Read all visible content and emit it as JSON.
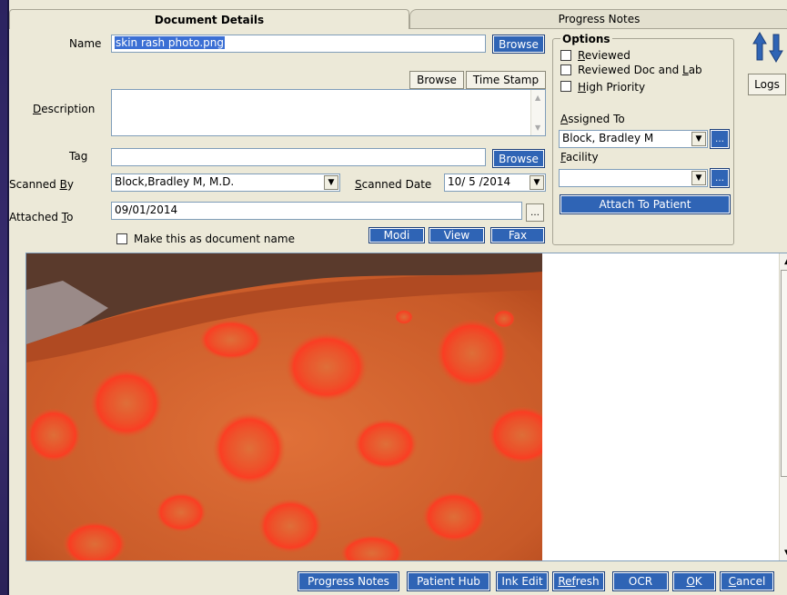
{
  "tabs": {
    "document_details": "Document Details",
    "progress_notes": "Progress Notes"
  },
  "name": {
    "label": "Name",
    "value": "skin rash photo.png",
    "browse": "Browse"
  },
  "browse2": "Browse",
  "time_stamp": "Time Stamp",
  "description": {
    "label_prefix": "",
    "label_u": "D",
    "label_rest": "escription",
    "value": ""
  },
  "tag": {
    "label": "Tag",
    "value": "",
    "browse": "Browse"
  },
  "scanned_by": {
    "label_a": "Scanned ",
    "label_u": "B",
    "label_b": "y",
    "value": "Block,Bradley M, M.D."
  },
  "scanned_date": {
    "label_u": "S",
    "label_b": "canned Date",
    "value": "10/ 5 /2014"
  },
  "attached_to": {
    "label_a": "Attached ",
    "label_u": "T",
    "label_b": "o",
    "value": "09/01/2014"
  },
  "make_doc_name": "Make this as document name",
  "buttons_row": {
    "modi": "Modi",
    "view": "View",
    "fax": "Fax"
  },
  "options": {
    "title": "Options",
    "reviewed_u": "R",
    "reviewed_rest": "eviewed",
    "reviewed_doc_lab_a": "Reviewed Doc and ",
    "reviewed_doc_lab_u": "L",
    "reviewed_doc_lab_b": "ab",
    "high_priority_u": "H",
    "high_priority_rest": "igh Priority",
    "assigned_to_u": "A",
    "assigned_to_rest": "ssigned To",
    "assigned_value": "Block, Bradley M",
    "facility_u": "F",
    "facility_rest": "acility",
    "facility_value": "",
    "attach": "Attach To Patient"
  },
  "logs": "Logs",
  "bottom_buttons": {
    "progress_notes": "Progress Notes",
    "patient_hub": "Patient Hub",
    "ink_edit": "Ink Edit",
    "refresh_u": "Ref",
    "refresh_rest": "resh",
    "ocr": "OCR",
    "ok_u": "O",
    "ok_rest": "K",
    "cancel_u": "C",
    "cancel_rest": "ancel"
  },
  "colors": {
    "accent_blue": "#2f64b5",
    "window_bg": "#ece9d8",
    "selection": "#3b6fd4"
  }
}
